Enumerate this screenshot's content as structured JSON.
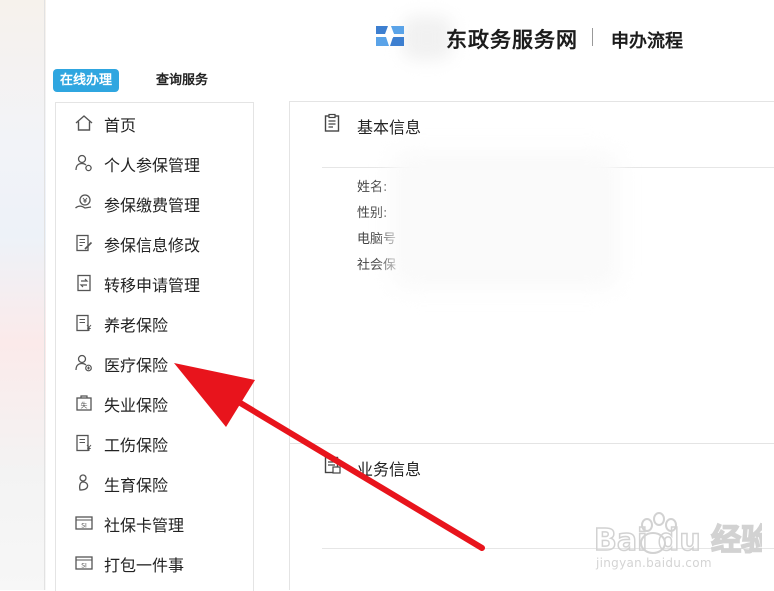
{
  "header": {
    "site_title": "东政务服务网",
    "sub_title": "申办流程"
  },
  "tabs": [
    {
      "label": "在线办理",
      "active": true
    },
    {
      "label": "查询服务",
      "active": false
    }
  ],
  "sidebar": {
    "items": [
      {
        "label": "首页",
        "icon": "home-icon"
      },
      {
        "label": "个人参保管理",
        "icon": "user-gear-icon"
      },
      {
        "label": "参保缴费管理",
        "icon": "payment-hand-icon"
      },
      {
        "label": "参保信息修改",
        "icon": "edit-document-icon"
      },
      {
        "label": "转移申请管理",
        "icon": "transfer-icon"
      },
      {
        "label": "养老保险",
        "icon": "document-yen-icon"
      },
      {
        "label": "医疗保险",
        "icon": "user-medical-icon"
      },
      {
        "label": "失业保险",
        "icon": "unemployment-icon"
      },
      {
        "label": "工伤保险",
        "icon": "document-yen-icon"
      },
      {
        "label": "生育保险",
        "icon": "maternity-icon"
      },
      {
        "label": "社保卡管理",
        "icon": "social-card-icon"
      },
      {
        "label": "打包一件事",
        "icon": "social-card-icon"
      }
    ]
  },
  "basic_info": {
    "title": "基本信息",
    "fields": [
      {
        "label": "姓名:"
      },
      {
        "label": "性别:"
      },
      {
        "label": "电脑号"
      },
      {
        "label": "社会保"
      }
    ]
  },
  "business_info": {
    "title": "业务信息"
  },
  "watermark": {
    "brand": "Bai du 经验",
    "url": "jingyan.baidu.com"
  },
  "colors": {
    "accent": "#2fa6e0",
    "arrow": "#e8141c",
    "logo": "#4a8fd6"
  }
}
